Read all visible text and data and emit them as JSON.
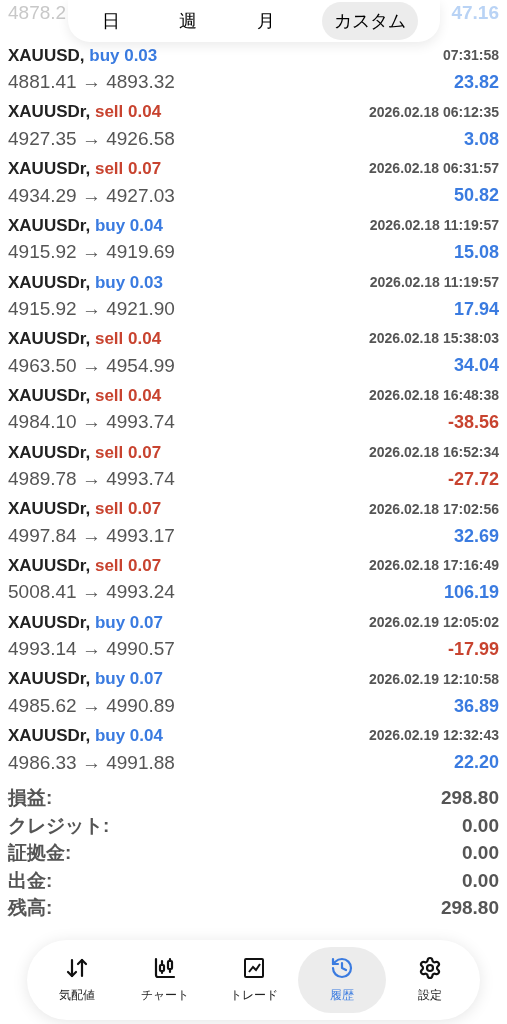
{
  "period_tabs": [
    {
      "label": "日",
      "selected": false
    },
    {
      "label": "週",
      "selected": false
    },
    {
      "label": "月",
      "selected": false
    },
    {
      "label": "カスタム",
      "selected": true
    }
  ],
  "partial_row": {
    "prices": "4878.2",
    "profit": "47.16"
  },
  "deals": [
    {
      "symbol": "XAUUSD,",
      "order": {
        "kind": "buy",
        "text": "buy 0.03"
      },
      "time": "07:31:58",
      "prices": "4881.41 → 4893.32",
      "profit": {
        "kind": "gain",
        "text": "23.82"
      }
    },
    {
      "symbol": "XAUUSDr,",
      "order": {
        "kind": "sell",
        "text": "sell 0.04"
      },
      "time": "2026.02.18 06:12:35",
      "prices": "4927.35 → 4926.58",
      "profit": {
        "kind": "gain",
        "text": "3.08"
      }
    },
    {
      "symbol": "XAUUSDr,",
      "order": {
        "kind": "sell",
        "text": "sell 0.07"
      },
      "time": "2026.02.18 06:31:57",
      "prices": "4934.29 → 4927.03",
      "profit": {
        "kind": "gain",
        "text": "50.82"
      }
    },
    {
      "symbol": "XAUUSDr,",
      "order": {
        "kind": "buy",
        "text": "buy 0.04"
      },
      "time": "2026.02.18 11:19:57",
      "prices": "4915.92 → 4919.69",
      "profit": {
        "kind": "gain",
        "text": "15.08"
      }
    },
    {
      "symbol": "XAUUSDr,",
      "order": {
        "kind": "buy",
        "text": "buy 0.03"
      },
      "time": "2026.02.18 11:19:57",
      "prices": "4915.92 → 4921.90",
      "profit": {
        "kind": "gain",
        "text": "17.94"
      }
    },
    {
      "symbol": "XAUUSDr,",
      "order": {
        "kind": "sell",
        "text": "sell 0.04"
      },
      "time": "2026.02.18 15:38:03",
      "prices": "4963.50 → 4954.99",
      "profit": {
        "kind": "gain",
        "text": "34.04"
      }
    },
    {
      "symbol": "XAUUSDr,",
      "order": {
        "kind": "sell",
        "text": "sell 0.04"
      },
      "time": "2026.02.18 16:48:38",
      "prices": "4984.10 → 4993.74",
      "profit": {
        "kind": "loss",
        "text": "-38.56"
      }
    },
    {
      "symbol": "XAUUSDr,",
      "order": {
        "kind": "sell",
        "text": "sell 0.07"
      },
      "time": "2026.02.18 16:52:34",
      "prices": "4989.78 → 4993.74",
      "profit": {
        "kind": "loss",
        "text": "-27.72"
      }
    },
    {
      "symbol": "XAUUSDr,",
      "order": {
        "kind": "sell",
        "text": "sell 0.07"
      },
      "time": "2026.02.18 17:02:56",
      "prices": "4997.84 → 4993.17",
      "profit": {
        "kind": "gain",
        "text": "32.69"
      }
    },
    {
      "symbol": "XAUUSDr,",
      "order": {
        "kind": "sell",
        "text": "sell 0.07"
      },
      "time": "2026.02.18 17:16:49",
      "prices": "5008.41 → 4993.24",
      "profit": {
        "kind": "gain",
        "text": "106.19"
      }
    },
    {
      "symbol": "XAUUSDr,",
      "order": {
        "kind": "buy",
        "text": "buy 0.07"
      },
      "time": "2026.02.19 12:05:02",
      "prices": "4993.14 → 4990.57",
      "profit": {
        "kind": "loss",
        "text": "-17.99"
      }
    },
    {
      "symbol": "XAUUSDr,",
      "order": {
        "kind": "buy",
        "text": "buy 0.07"
      },
      "time": "2026.02.19 12:10:58",
      "prices": "4985.62 → 4990.89",
      "profit": {
        "kind": "gain",
        "text": "36.89"
      }
    },
    {
      "symbol": "XAUUSDr,",
      "order": {
        "kind": "buy",
        "text": "buy 0.04"
      },
      "time": "2026.02.19 12:32:43",
      "prices": "4986.33 → 4991.88",
      "profit": {
        "kind": "gain",
        "text": "22.20"
      }
    }
  ],
  "summary": [
    {
      "label": "損益:",
      "value": "298.80"
    },
    {
      "label": "クレジット:",
      "value": "0.00"
    },
    {
      "label": "証拠金:",
      "value": "0.00"
    },
    {
      "label": "出金:",
      "value": "0.00"
    },
    {
      "label": "残高:",
      "value": "298.80"
    }
  ],
  "nav": [
    {
      "kind": "quotes",
      "label": "気配値",
      "selected": false
    },
    {
      "kind": "chart",
      "label": "チャート",
      "selected": false
    },
    {
      "kind": "trade",
      "label": "トレード",
      "selected": false
    },
    {
      "kind": "history",
      "label": "履歴",
      "selected": true
    },
    {
      "kind": "settings",
      "label": "設定",
      "selected": false
    }
  ]
}
